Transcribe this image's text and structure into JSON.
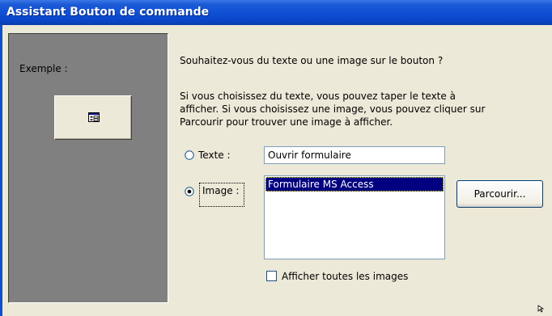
{
  "window": {
    "title": "Assistant Bouton de commande"
  },
  "preview": {
    "label": "Exemple :",
    "button_icon": "form-icon"
  },
  "question": "Souhaitez-vous du texte ou une image sur le bouton ?",
  "instructions": {
    "line1": "Si vous choisissez du texte, vous pouvez taper le texte à",
    "line2": "afficher. Si vous choisissez une image, vous pouvez cliquer sur",
    "line3": "Parcourir pour trouver une image à afficher."
  },
  "text_option": {
    "label": "Texte :",
    "selected": false,
    "value": "Ouvrir formulaire"
  },
  "image_option": {
    "label": "Image :",
    "selected": true,
    "items": [
      "Formulaire MS Access"
    ],
    "selected_item": "Formulaire MS Access"
  },
  "browse_button": {
    "label": "Parcourir..."
  },
  "show_all": {
    "label": "Afficher toutes les images",
    "checked": false
  },
  "colors": {
    "titlebar": "#0d4fd5",
    "panel": "#808080",
    "selection": "#000080",
    "face": "#ece9d8"
  }
}
